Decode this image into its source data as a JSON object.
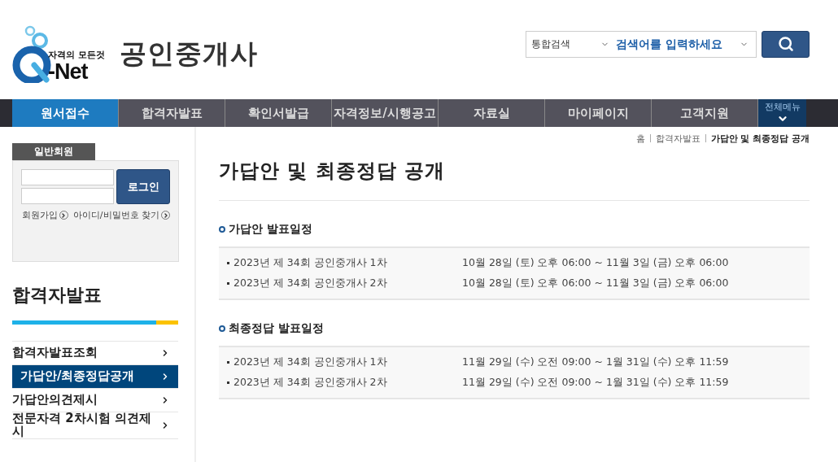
{
  "header": {
    "logo_tagline": "자격의 모든것",
    "logo_text": "-Net",
    "site_title": "공인중개사",
    "search": {
      "scope": "통합검색",
      "placeholder": "검색어를 입력하세요"
    }
  },
  "nav": {
    "items": [
      {
        "label": "원서접수",
        "selected": true
      },
      {
        "label": "합격자발표",
        "selected": false
      },
      {
        "label": "확인서발급",
        "selected": false
      },
      {
        "label": "자격정보/시행공고",
        "selected": false
      },
      {
        "label": "자료실",
        "selected": false
      },
      {
        "label": "마이페이지",
        "selected": false
      },
      {
        "label": "고객지원",
        "selected": false
      }
    ],
    "all_menu": "전체메뉴"
  },
  "login": {
    "tab": "일반회원",
    "button": "로그인",
    "links": [
      "회원가입",
      "아이디/비밀번호 찾기"
    ]
  },
  "sidebar": {
    "title": "합격자발표",
    "items": [
      {
        "label": "합격자발표조회",
        "selected": false
      },
      {
        "label": "가답안/최종정답공개",
        "selected": true
      },
      {
        "label": "가답안의견제시",
        "selected": false
      },
      {
        "label": "전문자격 2차시험 의견제시",
        "selected": false
      }
    ]
  },
  "breadcrumb": [
    "홈",
    "합격자발표",
    "가답안 및 최종정답 공개"
  ],
  "page_title": "가답안 및 최종정답 공개",
  "sections": [
    {
      "title": "가답안 발표일정",
      "rows": [
        {
          "exam": "2023년 제 34회 공인중개사 1차",
          "period": "10월 28일 (토) 오후 06:00 ~ 11월 3일 (금) 오후 06:00"
        },
        {
          "exam": "2023년 제 34회 공인중개사 2차",
          "period": "10월 28일 (토) 오후 06:00 ~ 11월 3일 (금) 오후 06:00"
        }
      ]
    },
    {
      "title": "최종정답 발표일정",
      "rows": [
        {
          "exam": "2023년 제 34회 공인중개사 1차",
          "period": "11월 29일 (수) 오전 09:00 ~ 1월 31일 (수) 오후 11:59"
        },
        {
          "exam": "2023년 제 34회 공인중개사 2차",
          "period": "11월 29일 (수) 오전 09:00 ~ 1월 31일 (수) 오후 11:59"
        }
      ]
    }
  ]
}
